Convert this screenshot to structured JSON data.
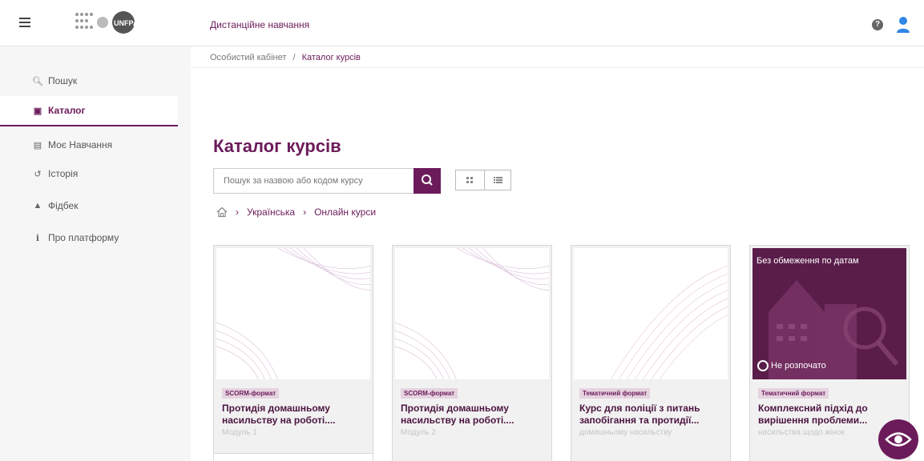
{
  "header": {
    "app_title": "Дистанційне навчання",
    "logo_text": "UNFPA",
    "help_symbol": "?"
  },
  "sidebar": {
    "items": [
      {
        "label": "Пошук",
        "icon": "search-icon",
        "active": false
      },
      {
        "label": "Каталог",
        "icon": "catalog-icon",
        "active": true
      },
      {
        "label": "Моє Навчання",
        "icon": "learning-icon",
        "active": false
      },
      {
        "label": "Історія",
        "icon": "history-icon",
        "active": false
      },
      {
        "label": "Фідбек",
        "icon": "thumbs-up-icon",
        "active": false
      },
      {
        "label": "Про платформу",
        "icon": "info-icon",
        "active": false
      }
    ]
  },
  "breadcrumb": {
    "home": "Особистий кабінет",
    "separator": "/",
    "current": "Каталог курсів"
  },
  "main": {
    "title": "Каталог курсів",
    "search": {
      "placeholder": "Пошук за назвою або кодом курсу"
    },
    "path": [
      {
        "label": "Українська"
      },
      {
        "label": "Онлайн курси"
      }
    ]
  },
  "cards": [
    {
      "badge": "SCORM-формат",
      "title": "Протидія домашньому насильству на роботі....",
      "fade": "Модуль 1"
    },
    {
      "badge": "SCORM-формат",
      "title": "Протидія домашньому насильству на роботі....",
      "fade": "Модуль 2"
    },
    {
      "badge": "Тематичний формат",
      "title": "Курс для поліції з питань запобігання та протидії...",
      "fade": "домашньому насильству"
    },
    {
      "badge": "Тематичний формат",
      "title": "Комплексний підхід до вирішення проблеми...",
      "fade": "насильства щодо жінок",
      "date_text": "Без обмеження по датам",
      "status": "Не розпочато"
    }
  ],
  "colors": {
    "accent": "#6b1b5a",
    "sidebar_bg": "#f6f6f6",
    "badge_bg": "#e6d3e0"
  }
}
